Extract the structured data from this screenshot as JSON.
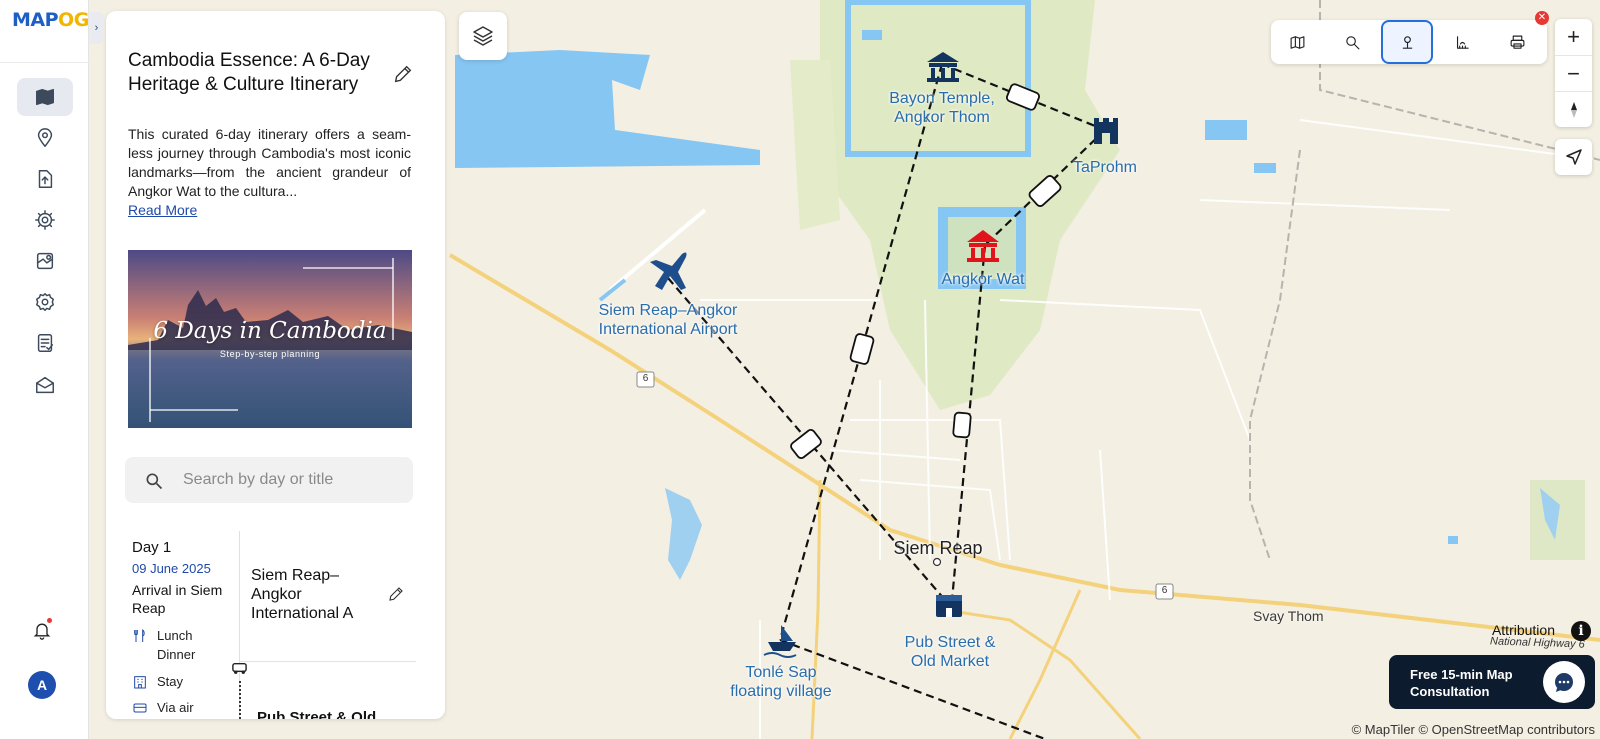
{
  "app": {
    "logo_part1": "MAP",
    "logo_part2": "OG"
  },
  "rail": {
    "items": [
      {
        "name": "map-icon"
      },
      {
        "name": "location-pin-icon"
      },
      {
        "name": "upload-icon"
      },
      {
        "name": "analysis-gear-icon"
      },
      {
        "name": "map-edit-icon"
      },
      {
        "name": "settings-icon"
      },
      {
        "name": "report-icon"
      },
      {
        "name": "share-map-icon"
      }
    ],
    "avatar_initial": "A"
  },
  "panel": {
    "title": "Cambodia Essence: A 6-Day Heritage & Culture Itinerary",
    "description": "This curated 6-day itinerary offers a seam-less journey through Cambodia's most iconic landmarks—from the ancient grandeur of Angkor Wat to the cultura...",
    "read_more": "Read More",
    "cover_title": "6 Days in Cambodia",
    "cover_subtitle": "Step-by-step planning",
    "search_placeholder": "Search by day or title",
    "day": {
      "label": "Day 1",
      "date": "09 June 2025",
      "arrival": "Arrival in Siem Reap",
      "meals": [
        "Lunch",
        "Dinner"
      ],
      "stay": "Stay",
      "transport": "Via air",
      "stop_title": "Siem Reap–Angkor International A",
      "next_stop_title": "Pub Street & Old"
    }
  },
  "map": {
    "labels": {
      "bayon": "Bayon Temple,\nAngkor Thom",
      "taprohm": "TaProhm",
      "angkorwat": "Angkor Wat",
      "airport": "Siem Reap–Angkor\nInternational Airport",
      "siemreap": "Siem Reap",
      "pubstreet": "Pub Street &\nOld Market",
      "tonlesap": "Tonlé Sap\nfloating village",
      "svaythom": "Svay Thom",
      "highway": "National Highway 6",
      "shield1": "6",
      "shield2": "6"
    },
    "attribution": "Attribution",
    "consult_line1": "Free 15-min Map",
    "consult_line2": "Consultation",
    "copyright": "© MapTiler © OpenStreetMap contributors"
  },
  "colors": {
    "brand_blue": "#1d5fc4",
    "brand_yellow": "#f2b600",
    "accent_red": "#e53935",
    "map_label": "#2a6dab"
  }
}
